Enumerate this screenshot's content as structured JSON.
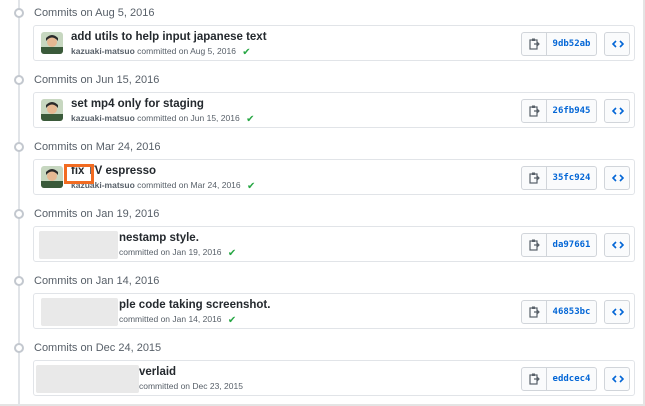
{
  "groups": [
    {
      "date": "Commits on Aug 5, 2016",
      "title": "add utils to help input japanese text",
      "author": "kazuaki-matsuo",
      "committed": "committed on Aug 5, 2016",
      "sha": "9db52ab",
      "has_avatar": true,
      "verified": true
    },
    {
      "date": "Commits on Jun 15, 2016",
      "title": "set mp4 only for staging",
      "author": "kazuaki-matsuo",
      "committed": "committed on Jun 15, 2016",
      "sha": "26fb945",
      "has_avatar": true,
      "verified": true
    },
    {
      "date": "Commits on Mar 24, 2016",
      "title": "fix TV espresso",
      "author": "kazuaki-matsuo",
      "committed": "committed on Mar 24, 2016",
      "sha": "35fc924",
      "has_avatar": true,
      "verified": true
    },
    {
      "date": "Commits on Jan 19, 2016",
      "title": "nestamp style.",
      "author": "",
      "committed": "committed on Jan 19, 2016",
      "sha": "da97661",
      "has_avatar": false,
      "verified": true
    },
    {
      "date": "Commits on Jan 14, 2016",
      "title": "ple code taking screenshot.",
      "author": "",
      "committed": "committed on Jan 14, 2016",
      "sha": "46853bc",
      "has_avatar": false,
      "verified": true
    },
    {
      "date": "Commits on Dec 24, 2015",
      "title": "verlaid",
      "author": "",
      "committed": "committed on Dec 23, 2015",
      "sha": "eddcec4",
      "has_avatar": false,
      "verified": false
    }
  ],
  "icons": {
    "copy": "clipboard-icon",
    "browse": "code-icon",
    "verified": "check-icon"
  },
  "colors": {
    "sha_link": "#0366d6",
    "verified": "#28a745",
    "highlight": "#f26b21"
  }
}
